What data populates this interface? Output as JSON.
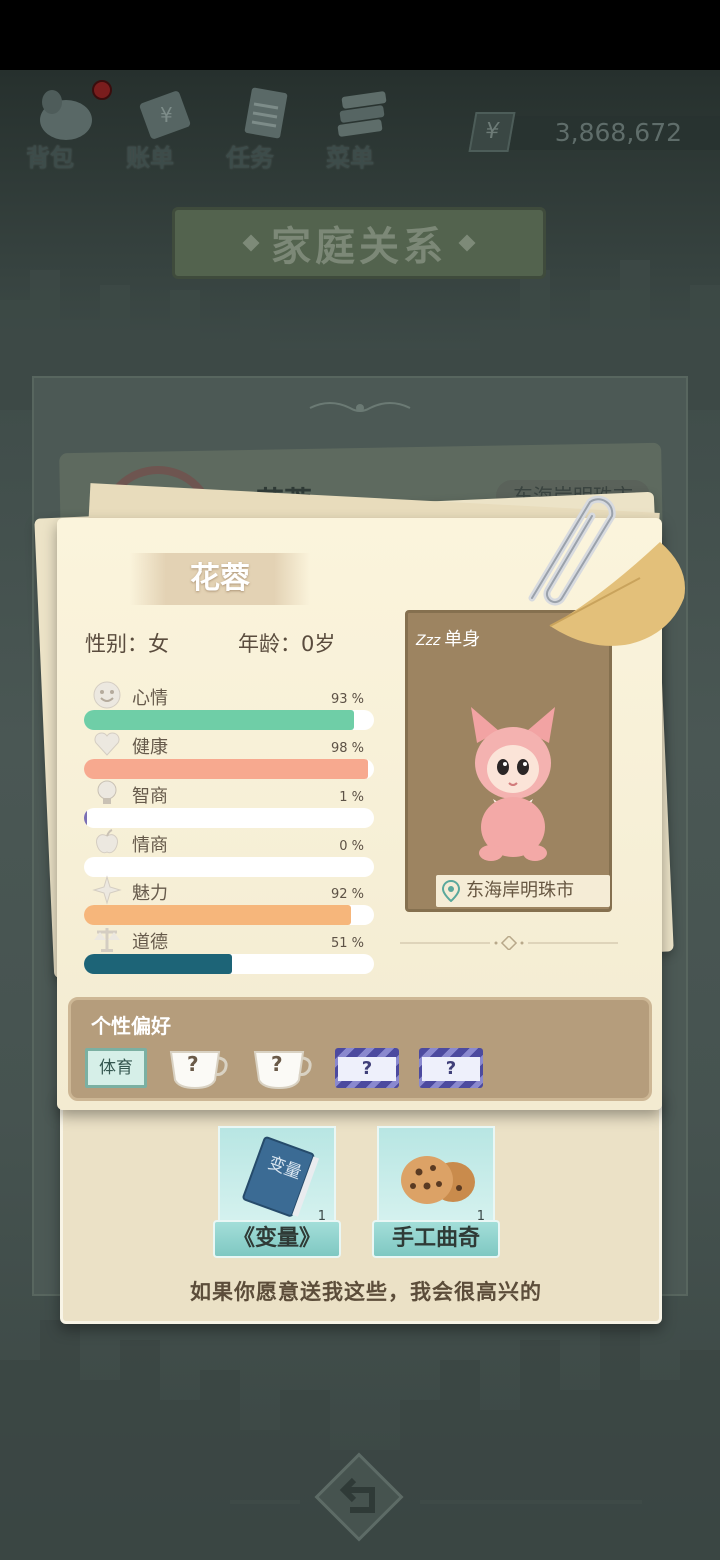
{
  "menu": {
    "items": [
      {
        "label": "背包",
        "icon": "backpack-icon"
      },
      {
        "label": "账单",
        "icon": "bill-icon"
      },
      {
        "label": "任务",
        "icon": "task-icon"
      },
      {
        "label": "菜单",
        "icon": "menu-icon"
      }
    ],
    "money_symbol": "¥",
    "money": "3,868,672"
  },
  "page_title": "家庭关系",
  "background_card": {
    "name": "花蓉",
    "location": "东海岸明珠市"
  },
  "profile": {
    "name": "花蓉",
    "gender": "性别：女",
    "age": "年龄：0岁",
    "status_zzz": "Zzz",
    "status": "单身",
    "location": "东海岸明珠市",
    "stats": [
      {
        "label": "心情",
        "pct_text": "93 %",
        "value": 0.93,
        "color": "#6fcea7",
        "icon": "smile-icon"
      },
      {
        "label": "健康",
        "pct_text": "98 %",
        "value": 0.98,
        "color": "#f7a98f",
        "icon": "heart-icon"
      },
      {
        "label": "智商",
        "pct_text": "1 %",
        "value": 0.01,
        "color": "#7a6fb4",
        "icon": "lightbulb-icon"
      },
      {
        "label": "情商",
        "pct_text": "0 %",
        "value": 0.0,
        "color": "#8fd4c9",
        "icon": "apple-icon"
      },
      {
        "label": "魅力",
        "pct_text": "92 %",
        "value": 0.92,
        "color": "#f6b67b",
        "icon": "sparkle-icon"
      },
      {
        "label": "道德",
        "pct_text": "51 %",
        "value": 0.51,
        "color": "#1d6477",
        "icon": "justice-scale-icon"
      }
    ]
  },
  "preferences": {
    "title": "个性偏好",
    "known": "体育",
    "unknown": [
      "?",
      "?",
      "?",
      "?"
    ]
  },
  "gifts": {
    "items": [
      {
        "name": "《变量》",
        "qty": "1",
        "book_title": "变量"
      },
      {
        "name": "手工曲奇",
        "qty": "1"
      }
    ],
    "message": "如果你愿意送我这些，我会很高兴的"
  }
}
